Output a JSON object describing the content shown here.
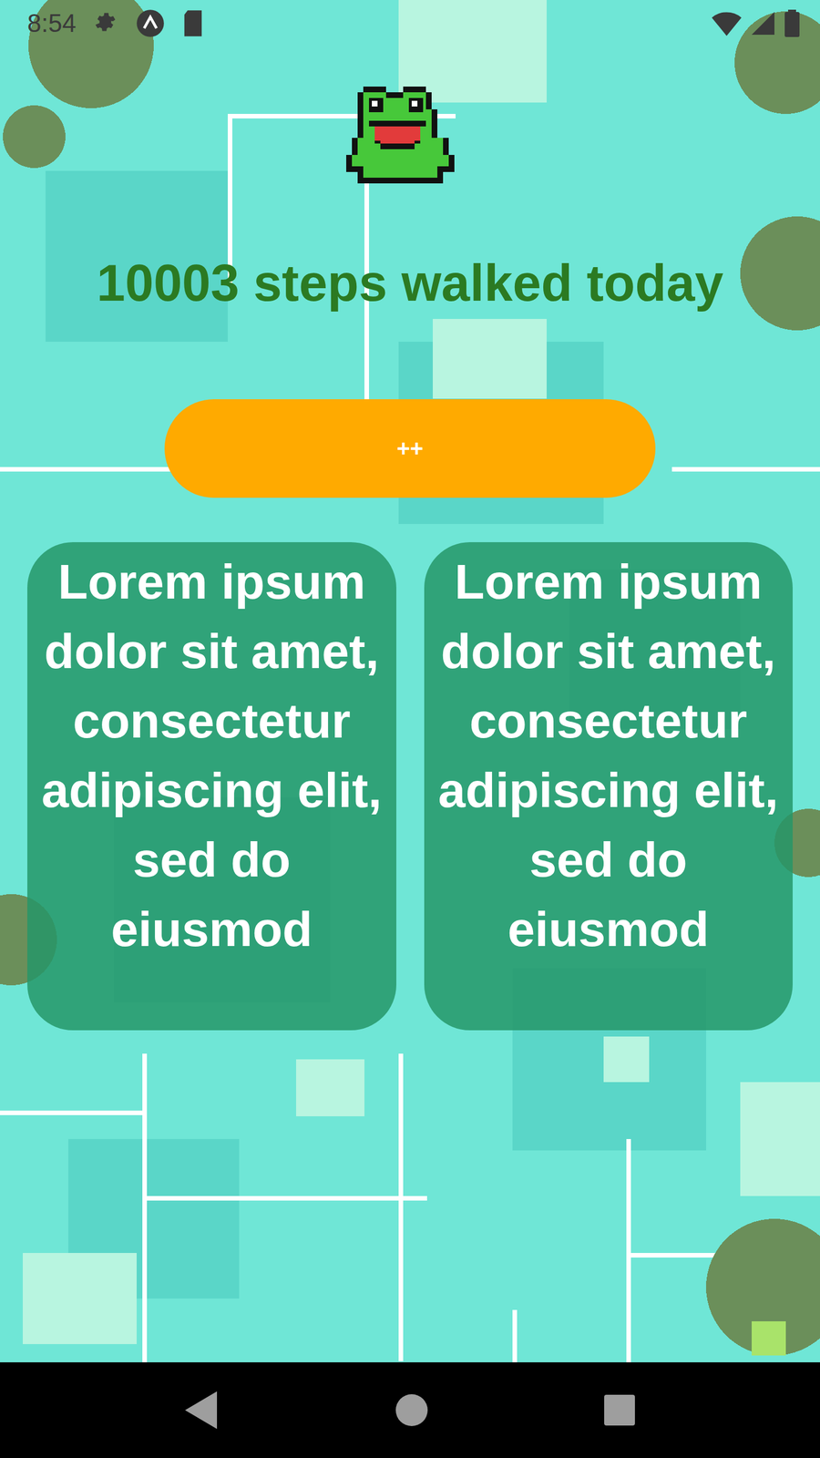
{
  "status_bar": {
    "time": "8:54"
  },
  "steps_title": "10003 steps walked today",
  "button": {
    "label": "++"
  },
  "cards": [
    {
      "text": "Lorem ipsum dolor sit amet, consectetur adipiscing elit, sed do eiusmod"
    },
    {
      "text": "Lorem ipsum dolor sit amet, consectetur adipiscing elit, sed do eiusmod"
    }
  ]
}
